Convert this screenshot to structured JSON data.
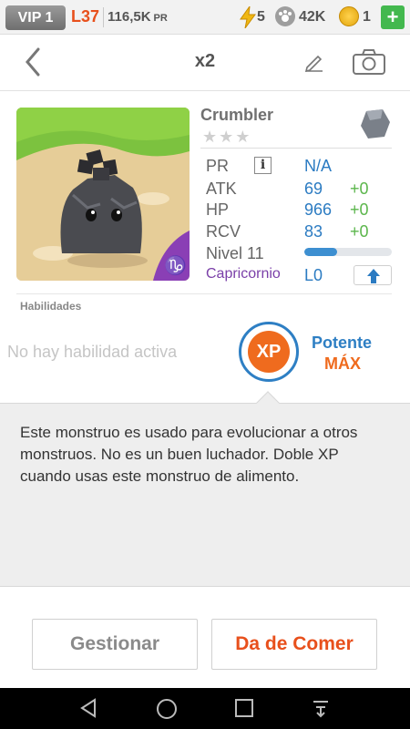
{
  "status": {
    "vip": "VIP 1",
    "level": "L37",
    "power": "116,5K",
    "power_unit": "PR",
    "energy": "5",
    "paws": "42K",
    "coins": "1",
    "plus": "+"
  },
  "header": {
    "title": "x2"
  },
  "monster": {
    "name": "Crumbler",
    "stars": "★★★",
    "star_rating": 0,
    "stats": {
      "pr_label": "PR",
      "pr_value": "N/A",
      "atk_label": "ATK",
      "atk_value": "69",
      "atk_bonus": "+0",
      "hp_label": "HP",
      "hp_value": "966",
      "hp_bonus": "+0",
      "rcv_label": "RCV",
      "rcv_value": "83",
      "rcv_bonus": "+0",
      "level_label": "Nivel 11",
      "level_progress_percent": 38
    },
    "zodiac": "Capricornio",
    "rank": "L0",
    "info_glyph": "i"
  },
  "abilities": {
    "title": "Habilidades",
    "empty_text": "No hay habilidad activa",
    "badge": "XP",
    "passive_name": "Potente",
    "passive_level": "MÁX"
  },
  "description": "Este monstruo es usado para evolucionar a otros monstruos. No es un buen luchador. Doble XP cuando usas este monstruo de alimento.",
  "buttons": {
    "manage": "Gestionar",
    "feed": "Da de Comer"
  },
  "colors": {
    "accent_orange": "#e8501c",
    "accent_blue": "#2b7bc2",
    "bonus_green": "#5bb64b",
    "zodiac_purple": "#7a3fa8"
  },
  "icons": [
    "back-chevron-icon",
    "pencil-icon",
    "camera-icon",
    "lightning-icon",
    "paw-icon",
    "coin-icon",
    "rock-element-icon",
    "info-icon",
    "arrow-up-icon",
    "nav-back-icon",
    "nav-home-icon",
    "nav-recents-icon",
    "nav-menu-icon"
  ]
}
